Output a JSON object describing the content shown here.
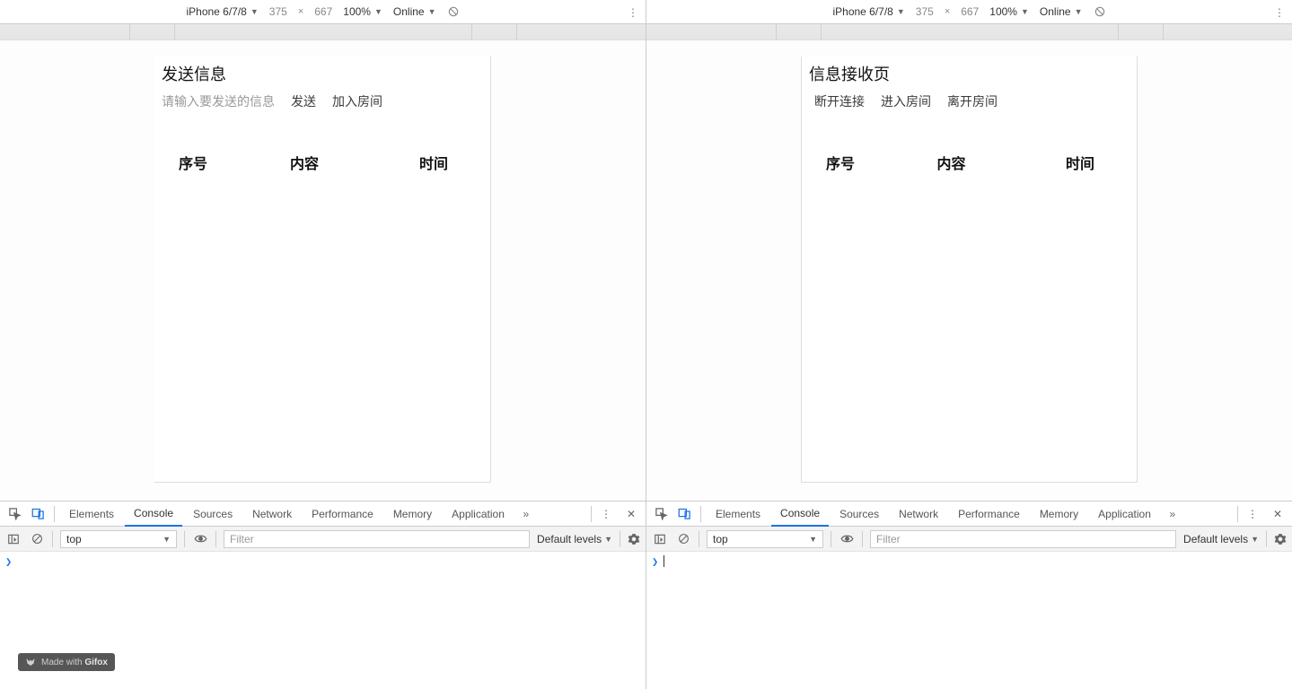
{
  "left": {
    "device_bar": {
      "device": "iPhone 6/7/8",
      "width": "375",
      "height": "667",
      "separator": "×",
      "zoom": "100%",
      "network": "Online"
    },
    "app": {
      "title": "发送信息",
      "input_placeholder": "请输入要发送的信息",
      "btn_send": "发送",
      "btn_join": "加入房间",
      "col_index": "序号",
      "col_content": "内容",
      "col_time": "时间"
    },
    "devtools": {
      "tabs": [
        "Elements",
        "Console",
        "Sources",
        "Network",
        "Performance",
        "Memory",
        "Application"
      ],
      "active_tab_index": 1,
      "context": "top",
      "filter_placeholder": "Filter",
      "levels": "Default levels",
      "prompt": "❯",
      "console_text": ""
    }
  },
  "right": {
    "device_bar": {
      "device": "iPhone 6/7/8",
      "width": "375",
      "height": "667",
      "separator": "×",
      "zoom": "100%",
      "network": "Online"
    },
    "app": {
      "title": "信息接收页",
      "btn_disconnect": "断开连接",
      "btn_enter": "进入房间",
      "btn_leave": "离开房间",
      "col_index": "序号",
      "col_content": "内容",
      "col_time": "时间"
    },
    "devtools": {
      "tabs": [
        "Elements",
        "Console",
        "Sources",
        "Network",
        "Performance",
        "Memory",
        "Application"
      ],
      "active_tab_index": 1,
      "context": "top",
      "filter_placeholder": "Filter",
      "levels": "Default levels",
      "prompt": "❯",
      "console_text": ""
    }
  },
  "gifox": {
    "prefix": "Made with",
    "brand": "Gifox"
  }
}
